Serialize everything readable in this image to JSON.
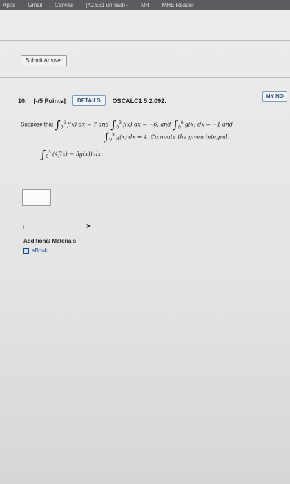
{
  "bookmarks": [
    "Apps",
    "Gmail",
    "Canvas",
    "(42,561 unread) -",
    "MH",
    "MHE Reader"
  ],
  "submit_label": "Submit Answer",
  "question": {
    "number": "10.",
    "points": "[-/5 Points]",
    "details_label": "DETAILS",
    "code": "OSCALC1 5.2.092.",
    "notes_label": "MY NO"
  },
  "prompt": {
    "lead": "Suppose that",
    "i1": "f(x) dx = 7 and",
    "i2": "f(x) dx = −6, and",
    "i3": "g(x) dx = −1 and",
    "i4": "g(x) dx = 4. Compute the given integral.",
    "lim1": "0",
    "lim6": "6",
    "lim3": "3"
  },
  "compute": "(4f(x) − 5g(x)) dx",
  "additional": "Additional Materials",
  "ebook": "eBook"
}
